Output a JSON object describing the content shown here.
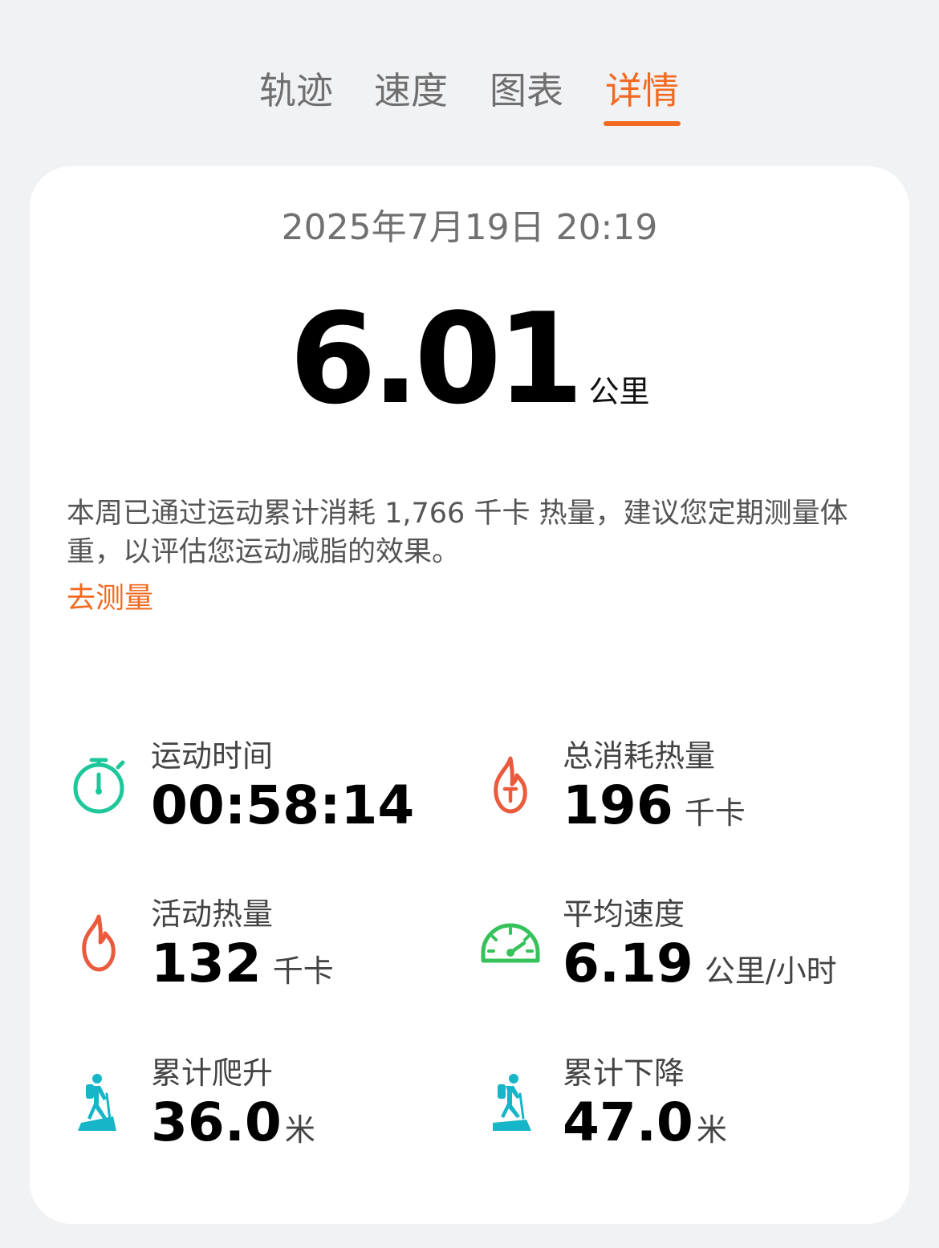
{
  "tabs": [
    {
      "label": "轨迹"
    },
    {
      "label": "速度"
    },
    {
      "label": "图表"
    },
    {
      "label": "详情"
    }
  ],
  "active_tab_index": 3,
  "summary": {
    "datetime": "2025年7月19日 20:19",
    "distance_value": "6.01",
    "distance_unit": "公里",
    "note": "本周已通过运动累计消耗 1,766 千卡 热量，建议您定期测量体重，以评估您运动减脂的效果。",
    "measure_link": "去测量"
  },
  "stats": {
    "duration": {
      "label": "运动时间",
      "value": "00:58:14",
      "icon": "stopwatch-icon",
      "color": "#1ec79a"
    },
    "total_calories": {
      "label": "总消耗热量",
      "value": "196",
      "unit": "千卡",
      "icon": "flame-t-icon",
      "color": "#ea5a3c"
    },
    "active_calories": {
      "label": "活动热量",
      "value": "132",
      "unit": "千卡",
      "icon": "flame-icon",
      "color": "#ea5a3c"
    },
    "avg_speed": {
      "label": "平均速度",
      "value": "6.19",
      "unit": "公里/小时",
      "icon": "speedometer-icon",
      "color": "#35c25a"
    },
    "ascent": {
      "label": "累计爬升",
      "value": "36.0",
      "unit": "米",
      "icon": "hiker-ascent-icon",
      "color": "#16b5c8"
    },
    "descent": {
      "label": "累计下降",
      "value": "47.0",
      "unit": "米",
      "icon": "hiker-descent-icon",
      "color": "#16b5c8"
    }
  },
  "colors": {
    "accent": "#f26a22",
    "background": "#f1f2f4",
    "card": "#ffffff"
  }
}
